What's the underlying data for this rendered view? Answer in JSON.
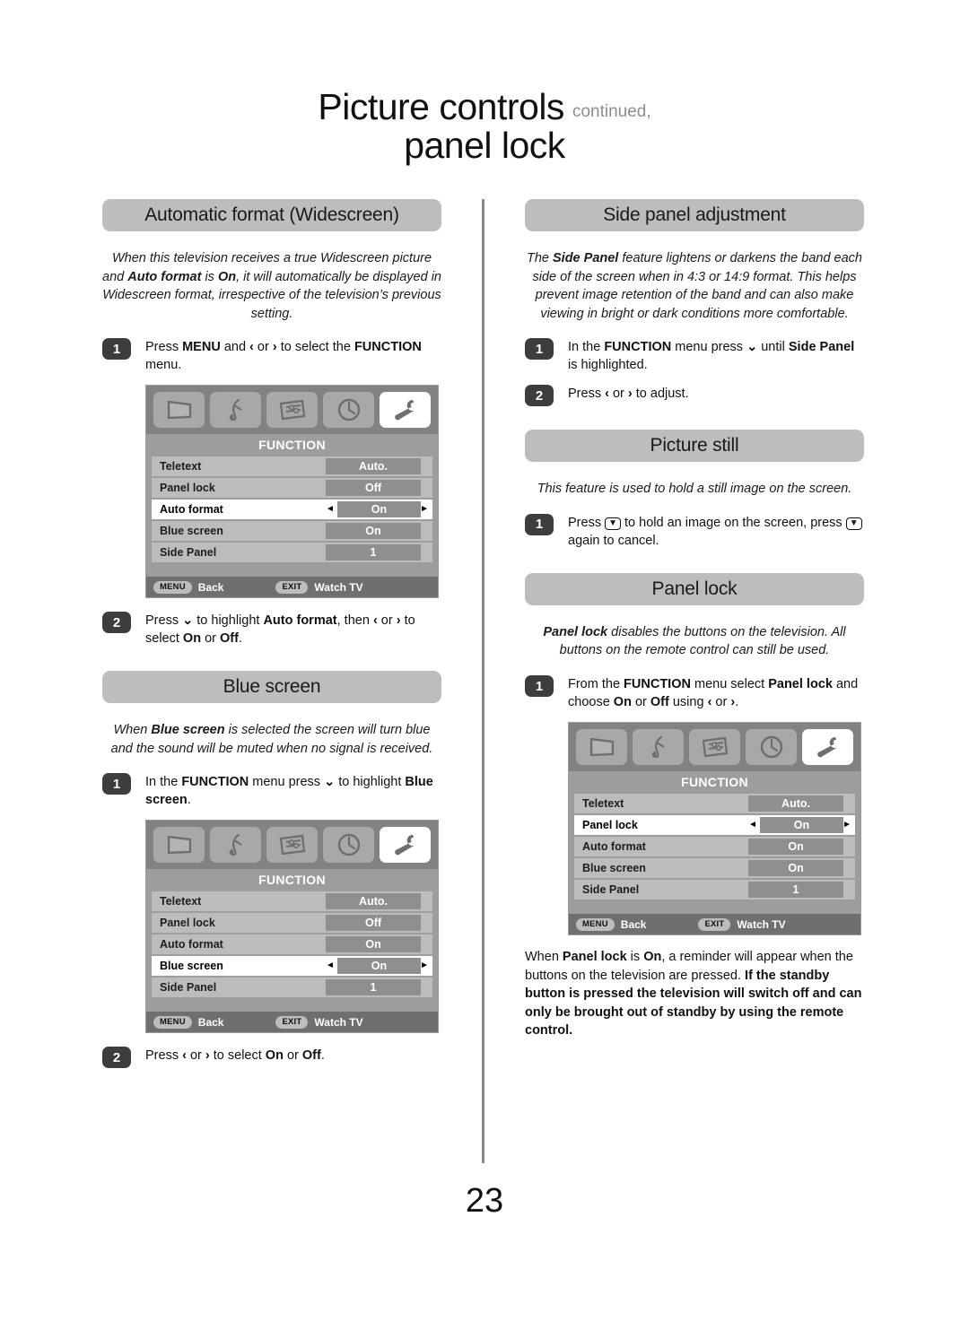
{
  "header": {
    "title": "Picture controls",
    "continued": "continued,",
    "subtitle": "panel lock"
  },
  "page_number": "23",
  "left_column": {
    "sections": [
      {
        "banner": "Automatic format (Widescreen)",
        "intro_html": "When this television receives a true Widescreen picture and <b>Auto format</b> is <b>On</b>, it will automatically be displayed in Widescreen format, irrespective of the television’s previous setting.",
        "steps_before": [
          {
            "number": "1",
            "html": "Press <b>MENU</b> and <b>‹</b> or <b>›</b> to select the <b>FUNCTION</b> menu."
          }
        ],
        "steps_after": [
          {
            "number": "2",
            "html": "Press <b>⌄</b> to highlight <b>Auto format</b>, then <b>‹</b> or <b>›</b> to select <b>On</b> or <b>Off</b>."
          }
        ]
      },
      {
        "banner": "Blue screen",
        "intro_html": "When <b>Blue screen</b> is selected the screen will turn blue and the sound will be muted when no signal is received.",
        "steps_before": [
          {
            "number": "1",
            "html": "In the <b>FUNCTION</b> menu press <b>⌄</b> to highlight <b>Blue screen</b>."
          }
        ],
        "steps_after": [
          {
            "number": "2",
            "html": "Press <b>‹</b> or <b>›</b> to select <b>On</b> or <b>Off</b>."
          }
        ]
      }
    ]
  },
  "right_column": {
    "sections": [
      {
        "banner": "Side panel adjustment",
        "intro_html": "The <b>Side Panel</b> feature lightens or darkens the band each side of the screen when in 4:3 or 14:9 format. This helps prevent image retention of the band and can also make viewing in bright or dark conditions more comfortable.",
        "steps": [
          {
            "number": "1",
            "html": "In the <b>FUNCTION</b> menu press <b>⌄</b> until <b>Side Panel</b> is highlighted."
          },
          {
            "number": "2",
            "html": "Press <b>‹</b> or <b>›</b> to adjust."
          }
        ]
      },
      {
        "banner": "Picture still",
        "intro_html": "This feature is used to hold a still image on the screen.",
        "steps": [
          {
            "number": "1",
            "html": "Press <span class=\"keybox\">▼</span> to hold an image on the screen, press <span class=\"keybox\">▼</span> again to cancel."
          }
        ]
      },
      {
        "banner": "Panel lock",
        "intro_html": "<b>Panel lock</b> disables the buttons on the television. All buttons on the remote control can still be used.",
        "steps": [
          {
            "number": "1",
            "html": "From the <b>FUNCTION</b> menu select <b>Panel lock</b> and choose <b>On</b> or <b>Off</b> using <b>‹</b> or <b>›</b>."
          }
        ],
        "closing_html": "When <b>Panel lock</b> is <b>On</b>, a reminder will appear when the buttons on the television are pressed. <b>If the standby button is pressed the television will switch off and can only be brought out of standby by using the remote control.</b>"
      }
    ]
  },
  "osd_menus": [
    {
      "id": "osd-auto-format",
      "title": "FUNCTION",
      "active_icon_index": 4,
      "icons": [
        "picture-icon",
        "sound-icon",
        "feature-icon",
        "timer-icon",
        "setup-wrench-icon"
      ],
      "rows": [
        {
          "label": "Teletext",
          "value": "Auto.",
          "selected": false
        },
        {
          "label": "Panel lock",
          "value": "Off",
          "selected": false
        },
        {
          "label": "Auto format",
          "value": "On",
          "selected": true
        },
        {
          "label": "Blue screen",
          "value": "On",
          "selected": false
        },
        {
          "label": "Side Panel",
          "value": "1",
          "selected": false
        }
      ],
      "footer": {
        "menu_key": "MENU",
        "menu_label": "Back",
        "exit_key": "EXIT",
        "exit_label": "Watch TV"
      }
    },
    {
      "id": "osd-blue-screen",
      "title": "FUNCTION",
      "active_icon_index": 4,
      "icons": [
        "picture-icon",
        "sound-icon",
        "feature-icon",
        "timer-icon",
        "setup-wrench-icon"
      ],
      "rows": [
        {
          "label": "Teletext",
          "value": "Auto.",
          "selected": false
        },
        {
          "label": "Panel lock",
          "value": "Off",
          "selected": false
        },
        {
          "label": "Auto format",
          "value": "On",
          "selected": false
        },
        {
          "label": "Blue screen",
          "value": "On",
          "selected": true
        },
        {
          "label": "Side Panel",
          "value": "1",
          "selected": false
        }
      ],
      "footer": {
        "menu_key": "MENU",
        "menu_label": "Back",
        "exit_key": "EXIT",
        "exit_label": "Watch TV"
      }
    },
    {
      "id": "osd-panel-lock",
      "title": "FUNCTION",
      "active_icon_index": 4,
      "icons": [
        "picture-icon",
        "sound-icon",
        "feature-icon",
        "timer-icon",
        "setup-wrench-icon"
      ],
      "rows": [
        {
          "label": "Teletext",
          "value": "Auto.",
          "selected": false
        },
        {
          "label": "Panel lock",
          "value": "On",
          "selected": true
        },
        {
          "label": "Auto format",
          "value": "On",
          "selected": false
        },
        {
          "label": "Blue screen",
          "value": "On",
          "selected": false
        },
        {
          "label": "Side Panel",
          "value": "1",
          "selected": false
        }
      ],
      "footer": {
        "menu_key": "MENU",
        "menu_label": "Back",
        "exit_key": "EXIT",
        "exit_label": "Watch TV"
      }
    }
  ],
  "colors": {
    "banner_bg": "#bdbdbd",
    "step_badge_bg": "#3d3d3d",
    "osd_icon_bar": "#828282",
    "osd_body": "#9d9d9d",
    "osd_row": "#bcbcbc",
    "osd_value": "#8f8f8f",
    "osd_footer": "#6f6f6f",
    "divider": "#8a8a8a",
    "continued_text": "#8d8d8d"
  }
}
